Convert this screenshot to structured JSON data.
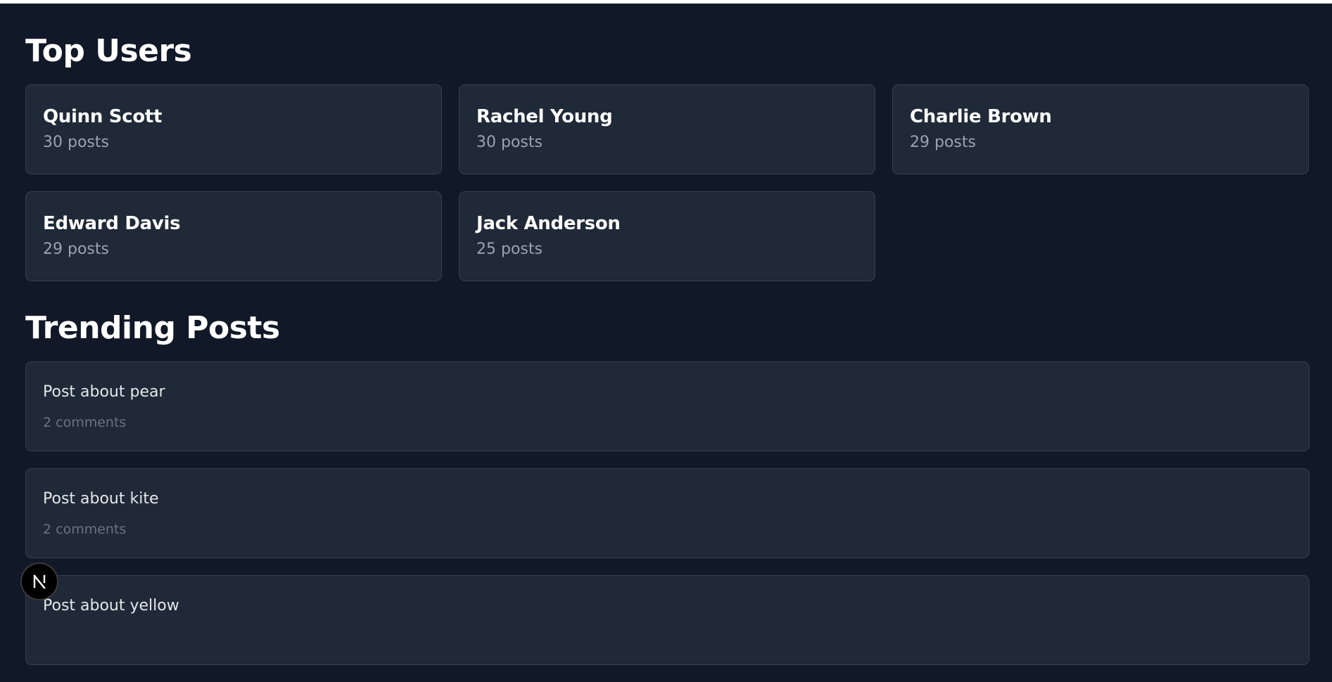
{
  "sections": {
    "top_users_title": "Top Users",
    "trending_posts_title": "Trending Posts"
  },
  "top_users": [
    {
      "name": "Quinn Scott",
      "posts": "30 posts"
    },
    {
      "name": "Rachel Young",
      "posts": "30 posts"
    },
    {
      "name": "Charlie Brown",
      "posts": "29 posts"
    },
    {
      "name": "Edward Davis",
      "posts": "29 posts"
    },
    {
      "name": "Jack Anderson",
      "posts": "25 posts"
    }
  ],
  "trending_posts": [
    {
      "title": "Post about pear",
      "comments": "2 comments"
    },
    {
      "title": "Post about kite",
      "comments": "2 comments"
    },
    {
      "title": "Post about yellow",
      "comments": ""
    }
  ],
  "dev_badge": {
    "icon": "nextjs-logo-icon",
    "letter": "N"
  },
  "colors": {
    "background": "#111827",
    "card": "#1f2937",
    "card_border": "#334155",
    "muted_text": "#9ca3af"
  }
}
